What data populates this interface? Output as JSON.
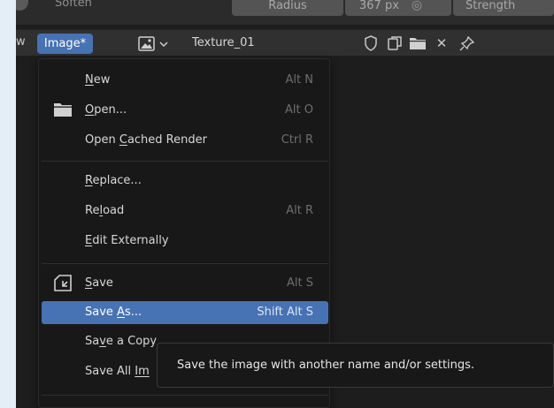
{
  "toolbar": {
    "soften_label": "Soften",
    "radius_label": "Radius",
    "radius_value": "367 px",
    "strength_label": "Strength"
  },
  "header": {
    "view_label": "w",
    "image_menu_label": "Image*",
    "texture_name": "Texture_01"
  },
  "menu": {
    "items": [
      {
        "pre": "",
        "u": "N",
        "post": "ew",
        "shortcut": "Alt N"
      },
      {
        "pre": "",
        "u": "O",
        "post": "pen...",
        "shortcut": "Alt O"
      },
      {
        "pre": "Open ",
        "u": "C",
        "post": "ached Render",
        "shortcut": "Ctrl R"
      },
      {
        "pre": "",
        "u": "R",
        "post": "eplace...",
        "shortcut": ""
      },
      {
        "pre": "Re",
        "u": "l",
        "post": "oad",
        "shortcut": "Alt R"
      },
      {
        "pre": "",
        "u": "E",
        "post": "dit Externally",
        "shortcut": ""
      },
      {
        "pre": "",
        "u": "S",
        "post": "ave",
        "shortcut": "Alt S"
      },
      {
        "pre": "Save ",
        "u": "A",
        "post": "s...",
        "shortcut": "Shift Alt S"
      },
      {
        "pre": "Sa",
        "u": "v",
        "post": "e a Copy",
        "shortcut": ""
      },
      {
        "pre": "Save All ",
        "u": "Im",
        "post": "",
        "shortcut": ""
      }
    ]
  },
  "tooltip": {
    "text": "Save the image with another name and/or settings."
  },
  "colors": {
    "accent": "#4772b3",
    "menu_bg": "#181818",
    "shortcut": "#6e6e6e"
  }
}
